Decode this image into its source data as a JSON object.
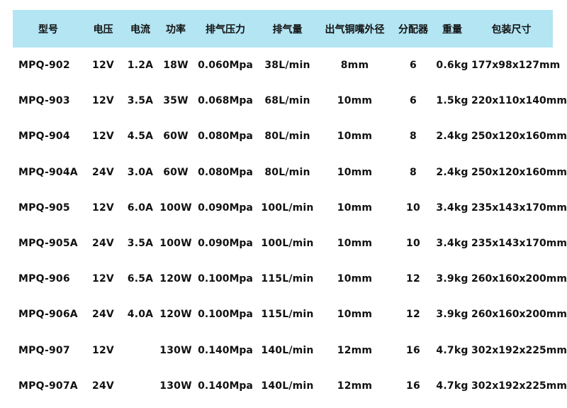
{
  "table": {
    "headers": [
      "型号",
      "电压",
      "电流",
      "功率",
      "排气压力",
      "排气量",
      "出气铜嘴外径",
      "分配器",
      "重量",
      "包装尺寸"
    ],
    "rows": [
      [
        "MPQ-902",
        "12V",
        "1.2A",
        "18W",
        "0.060Mpa",
        "38L/min",
        "8mm",
        "6",
        "0.6kg",
        "177x98x127mm"
      ],
      [
        "MPQ-903",
        "12V",
        "3.5A",
        "35W",
        "0.068Mpa",
        "68L/min",
        "10mm",
        "6",
        "1.5kg",
        "220x110x140mm"
      ],
      [
        "MPQ-904",
        "12V",
        "4.5A",
        "60W",
        "0.080Mpa",
        "80L/min",
        "10mm",
        "8",
        "2.4kg",
        "250x120x160mm"
      ],
      [
        "MPQ-904A",
        "24V",
        "3.0A",
        "60W",
        "0.080Mpa",
        "80L/min",
        "10mm",
        "8",
        "2.4kg",
        "250x120x160mm"
      ],
      [
        "MPQ-905",
        "12V",
        "6.0A",
        "100W",
        "0.090Mpa",
        "100L/min",
        "10mm",
        "10",
        "3.4kg",
        "235x143x170mm"
      ],
      [
        "MPQ-905A",
        "24V",
        "3.5A",
        "100W",
        "0.090Mpa",
        "100L/min",
        "10mm",
        "10",
        "3.4kg",
        "235x143x170mm"
      ],
      [
        "MPQ-906",
        "12V",
        "6.5A",
        "120W",
        "0.100Mpa",
        "115L/min",
        "10mm",
        "12",
        "3.9kg",
        "260x160x200mm"
      ],
      [
        "MPQ-906A",
        "24V",
        "4.0A",
        "120W",
        "0.100Mpa",
        "115L/min",
        "10mm",
        "12",
        "3.9kg",
        "260x160x200mm"
      ],
      [
        "MPQ-907",
        "12V",
        "",
        "130W",
        "0.140Mpa",
        "140L/min",
        "12mm",
        "16",
        "4.7kg",
        "302x192x225mm"
      ],
      [
        "MPQ-907A",
        "24V",
        "",
        "130W",
        "0.140Mpa",
        "140L/min",
        "12mm",
        "16",
        "4.7kg",
        "302x192x225mm"
      ]
    ]
  },
  "colors": {
    "header_background": "#b3e5f3",
    "text": "#111111",
    "page_background": "#ffffff"
  }
}
